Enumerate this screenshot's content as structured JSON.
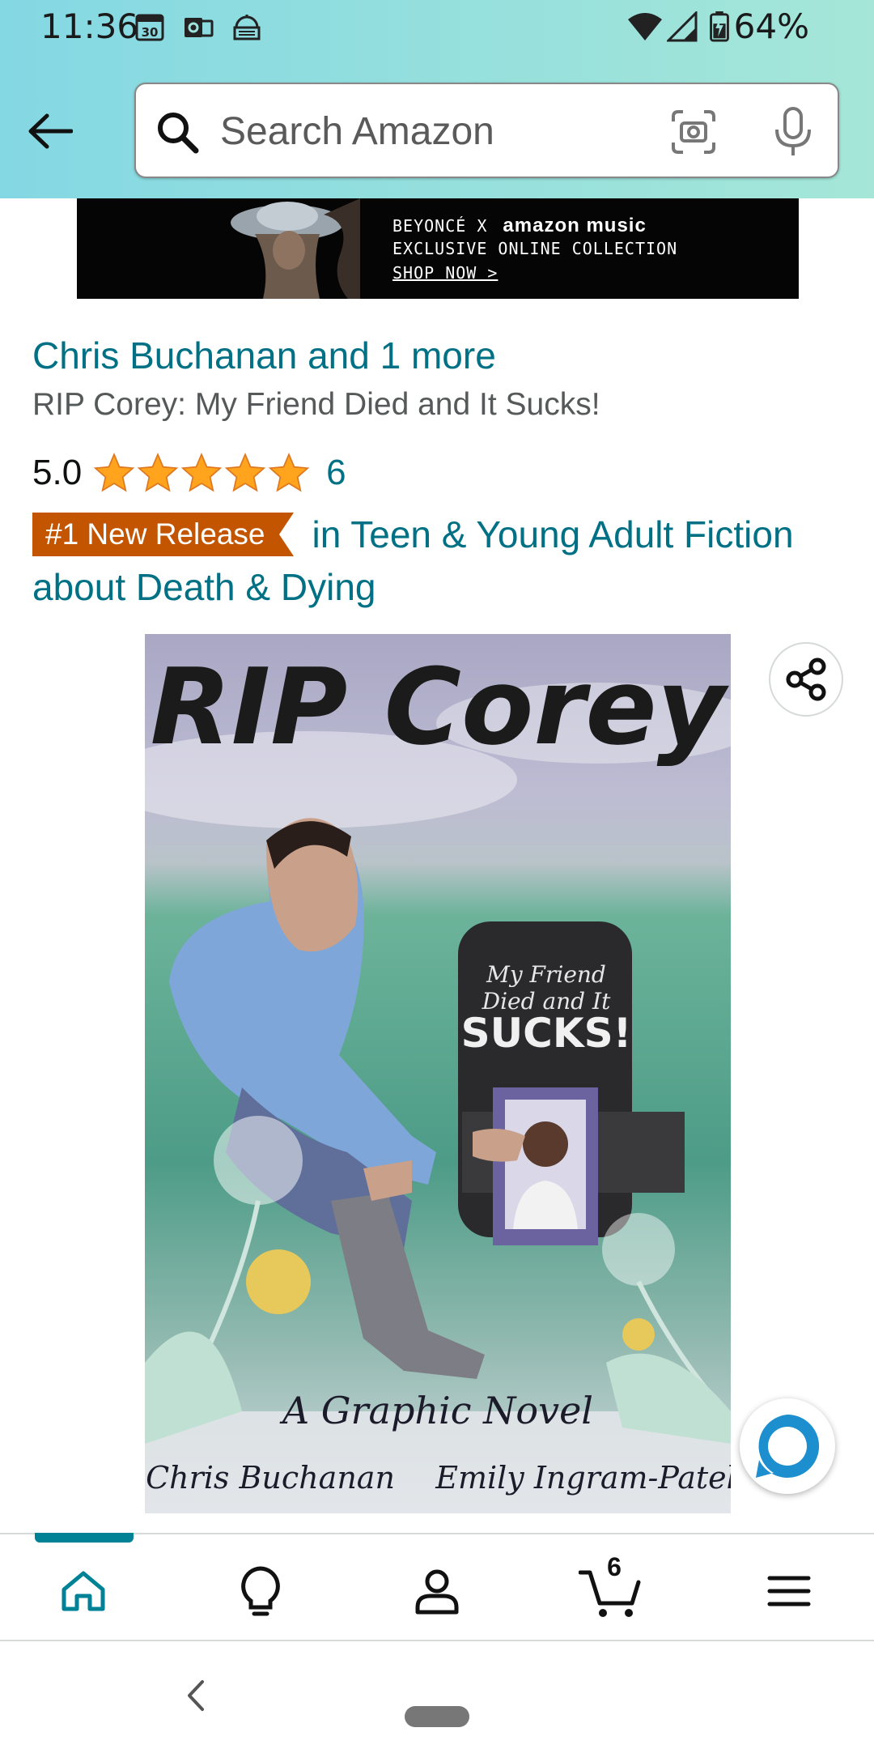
{
  "status_bar": {
    "time": "11:36",
    "battery": "64%"
  },
  "search": {
    "placeholder": "Search Amazon"
  },
  "banner": {
    "line1_prefix": "BEYONCÉ X",
    "line1_brand": "amazon music",
    "line2": "EXCLUSIVE ONLINE COLLECTION",
    "line3": "SHOP NOW >"
  },
  "product": {
    "authors_link": "Chris Buchanan and 1 more",
    "title": "RIP Corey: My Friend Died and It Sucks!",
    "rating": "5.0",
    "stars": 5,
    "review_count": "6",
    "badge": "#1 New Release",
    "category_link": "in Teen & Young Adult Fiction about Death & Dying"
  },
  "cover": {
    "title": "RIP Corey",
    "tombstone_line1": "My Friend",
    "tombstone_line2": "Died and It",
    "tombstone_line3": "SUCKS!",
    "subtitle": "A Graphic Novel",
    "author1": "Chris Buchanan",
    "author2": "Emily Ingram-Patel"
  },
  "bottom_nav": {
    "items": [
      "home-icon",
      "inspire-icon",
      "account-icon",
      "cart-icon",
      "menu-icon"
    ],
    "cart_count": "6",
    "active": "home"
  },
  "colors": {
    "header_gradient_start": "#84d8e3",
    "header_gradient_end": "#a5e6d8",
    "link": "#007185",
    "badge": "#c45500",
    "star": "#ffa41c",
    "nav_active": "#008296"
  }
}
